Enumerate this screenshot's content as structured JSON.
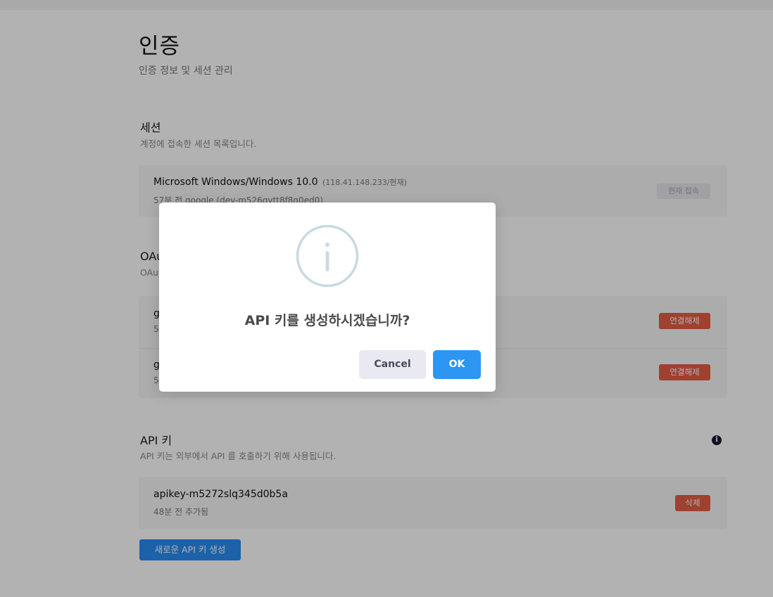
{
  "page": {
    "title": "인증",
    "subtitle": "인증 정보 및 세션 관리"
  },
  "sessions": {
    "title": "세션",
    "description": "계정에 접속한 세션 목록입니다.",
    "items": [
      {
        "device": "Microsoft Windows/Windows 10.0",
        "ip": "(118.41.148.233/현재)",
        "detail": "57분 전 google (dev-m526gytt8f8q0ed0)",
        "status": "현재 접속"
      }
    ]
  },
  "oauth": {
    "title": "OAu",
    "description": "OAut",
    "items": [
      {
        "name": "g",
        "detail": "5",
        "action": "연결해제"
      },
      {
        "name": "g",
        "detail": "5",
        "action": "연결해제"
      }
    ]
  },
  "api_keys": {
    "title": "API 키",
    "description": "API 키는 외부에서 API 를 호출하기 위해 사용됩니다.",
    "info_icon": "i",
    "items": [
      {
        "name": "apikey-m5272slq345d0b5a",
        "detail": "48분 전 추가됨",
        "action": "삭제"
      }
    ],
    "create_button": "새로운 API 키 생성"
  },
  "modal": {
    "icon": "info-circle-icon",
    "message": "API 키를 생성하시겠습니까?",
    "cancel_label": "Cancel",
    "ok_label": "OK"
  },
  "colors": {
    "primary": "#2a8bf2",
    "danger": "#e35d44",
    "ok_button": "#2d96f3",
    "cancel_button": "#e9e9f2",
    "overlay": "rgba(0,0,0,0.30)"
  }
}
